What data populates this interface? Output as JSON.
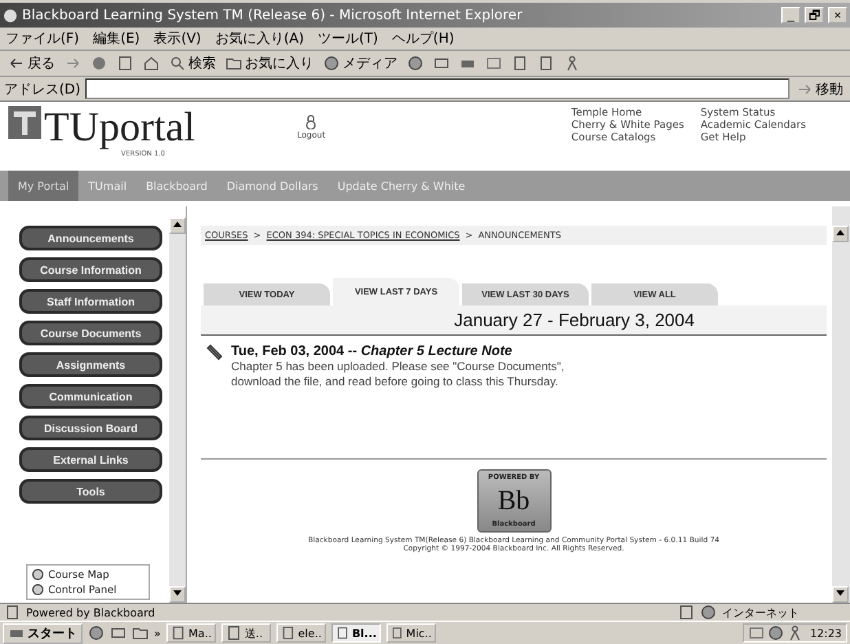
{
  "window": {
    "title": "Blackboard Learning System TM (Release 6) - Microsoft Internet Explorer",
    "controls": [
      "_",
      "🗗",
      "×"
    ]
  },
  "menu": [
    "ファイル(F)",
    "編集(E)",
    "表示(V)",
    "お気に入り(A)",
    "ツール(T)",
    "ヘルプ(H)"
  ],
  "toolbar": [
    {
      "kind": "labeled",
      "label": "戻る"
    },
    {
      "kind": "icon"
    },
    {
      "kind": "icon"
    },
    {
      "kind": "icon"
    },
    {
      "kind": "icon"
    },
    {
      "kind": "labeled",
      "label": "検索"
    },
    {
      "kind": "labeled",
      "label": "お気に入り"
    },
    {
      "kind": "labeled",
      "label": "メディア"
    },
    {
      "kind": "icon"
    },
    {
      "kind": "icon"
    },
    {
      "kind": "icon"
    },
    {
      "kind": "icon"
    },
    {
      "kind": "icon"
    },
    {
      "kind": "icon"
    },
    {
      "kind": "icon"
    }
  ],
  "address": {
    "label": "アドレス(D)",
    "go": "移動"
  },
  "portal": {
    "logo": "TUportal",
    "version": "VERSION 1.0",
    "logout": "Logout",
    "links": [
      [
        "Temple Home",
        "Cherry & White Pages",
        "Course Catalogs"
      ],
      [
        "System Status",
        "Academic Calendars",
        "Get Help"
      ]
    ]
  },
  "nav": [
    {
      "label": "My Portal",
      "selected": true
    },
    {
      "label": "TUmail",
      "selected": false
    },
    {
      "label": "Blackboard",
      "selected": false
    },
    {
      "label": "Diamond Dollars",
      "selected": false
    },
    {
      "label": "Update Cherry & White",
      "selected": false
    }
  ],
  "sidebar": {
    "buttons": [
      "Announcements",
      "Course Information",
      "Staff Information",
      "Course Documents",
      "Assignments",
      "Communication",
      "Discussion Board",
      "External Links",
      "Tools"
    ],
    "tools": [
      "Course Map",
      "Control Panel"
    ]
  },
  "breadcrumb": {
    "separator": ">",
    "items": [
      {
        "label": "COURSES",
        "link": true
      },
      {
        "label": "ECON 394: SPECIAL TOPICS IN ECONOMICS",
        "link": true
      },
      {
        "label": "ANNOUNCEMENTS",
        "link": false
      }
    ]
  },
  "tabs": [
    {
      "label": "VIEW TODAY",
      "selected": false
    },
    {
      "label": "VIEW LAST 7 DAYS",
      "selected": true
    },
    {
      "label": "VIEW LAST 30 DAYS",
      "selected": false
    },
    {
      "label": "VIEW ALL",
      "selected": false
    }
  ],
  "range": "January 27 - February 3, 2004",
  "announcements": [
    {
      "date": "Tue, Feb 03, 2004",
      "dash": "--",
      "title": "Chapter 5 Lecture Note",
      "body": "Chapter 5 has been uploaded. Please see \"Course Documents\", download the file, and read before going to class this Thursday."
    }
  ],
  "badge": {
    "top": "POWERED BY",
    "mark": "Bb",
    "bottom": "Blackboard"
  },
  "footer": [
    "Blackboard Learning System TM(Release 6) Blackboard Learning and Community Portal System - 6.0.11 Build 74",
    "Copyright © 1997-2004 Blackboard Inc. All Rights Reserved."
  ],
  "status_bar": {
    "text": "Powered by Blackboard",
    "zone": "インターネット"
  },
  "taskbar": {
    "start": "スタート",
    "more": "»",
    "tasks": [
      {
        "label": "Ma..",
        "selected": false
      },
      {
        "label": "送..",
        "selected": false
      },
      {
        "label": "ele..",
        "selected": false
      },
      {
        "label": "Bl...",
        "selected": true
      },
      {
        "label": "Mic..",
        "selected": false
      }
    ],
    "clock": "12:23"
  }
}
